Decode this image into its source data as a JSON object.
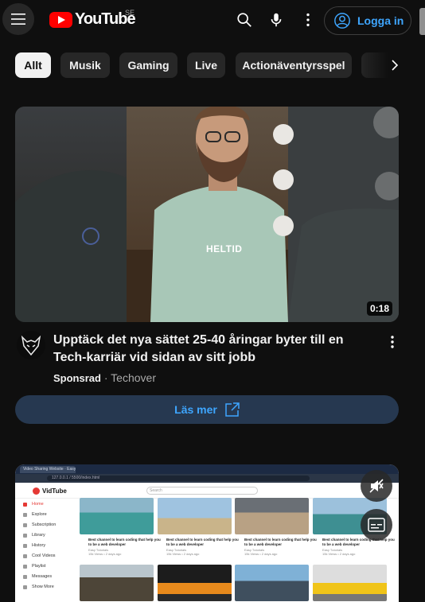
{
  "header": {
    "logo_text": "YouTube",
    "country_code": "SE",
    "login_label": "Logga in",
    "icons": [
      "menu-icon",
      "search-icon",
      "mic-icon",
      "more-vert-icon",
      "account-icon"
    ]
  },
  "chips": [
    {
      "label": "Allt",
      "active": true
    },
    {
      "label": "Musik",
      "active": false
    },
    {
      "label": "Gaming",
      "active": false
    },
    {
      "label": "Live",
      "active": false
    },
    {
      "label": "Actionäventyrsspel",
      "active": false
    }
  ],
  "ad": {
    "overlay_text": "HELTID",
    "duration": "0:18",
    "title": "Upptäck det nya sättet 25-40 åringar byter till en Tech-karriär vid sidan av sitt jobb",
    "sponsored_label": "Sponsrad",
    "separator": "·",
    "advertiser": "Techover",
    "cta_label": "Läs mer"
  },
  "second_video": {
    "browser_tab": "Video Sharing Website · Easy T…",
    "url": "127.0.0.1 / 5500/index.html",
    "site_logo": "VidTube",
    "search_placeholder": "Search",
    "sidebar": [
      "Home",
      "Explore",
      "Subscription",
      "Library",
      "History",
      "Cool Videos",
      "Playlist",
      "Messages",
      "Show More"
    ],
    "card_title": "Best channel to learn coding that help you to be a web developer",
    "card_channel": "Easy Tutorials",
    "card_stats": "15k Views • 2 days ago",
    "overlay_icons": [
      "mute-icon",
      "captions-icon"
    ]
  },
  "colors": {
    "background": "#0f0f0f",
    "accent_blue": "#3ea6ff",
    "chip_bg": "#272727",
    "cta_bg": "#263850",
    "brand_red": "#ff0000"
  }
}
